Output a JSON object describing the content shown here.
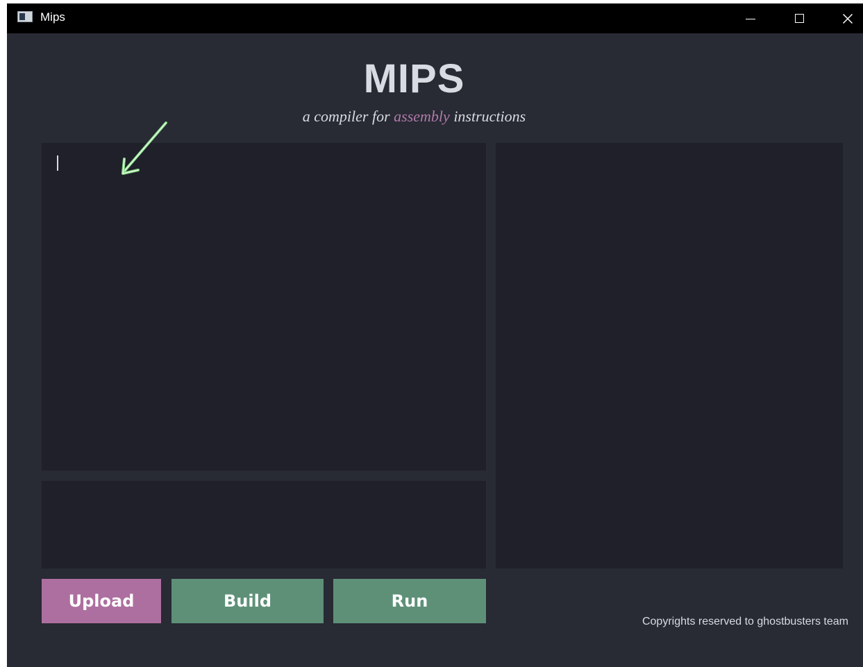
{
  "window": {
    "title": "Mips",
    "controls": {
      "minimize_icon": "minimize-icon",
      "maximize_icon": "maximize-icon",
      "close_icon": "close-icon",
      "close_glyph": "✕"
    }
  },
  "header": {
    "title": "MIPS",
    "subtitle_prefix": "a compiler for ",
    "subtitle_accent": "assembly",
    "subtitle_suffix": "  instructions"
  },
  "editor": {
    "value": "",
    "annotation_icon": "green-arrow-icon"
  },
  "console": {
    "value": ""
  },
  "output": {
    "value": ""
  },
  "buttons": {
    "upload": "Upload",
    "build": "Build",
    "run": "Run"
  },
  "footer": {
    "text": "Copyrights reserved to ghostbusters team"
  },
  "colors": {
    "background": "#282a34",
    "panel": "#1f2029",
    "text": "#d9dbe3",
    "accent_purple": "#ad6f9f",
    "accent_green": "#5e9078",
    "subtitle_accent": "#b07aa8",
    "annotation_arrow": "#7fd67f"
  }
}
